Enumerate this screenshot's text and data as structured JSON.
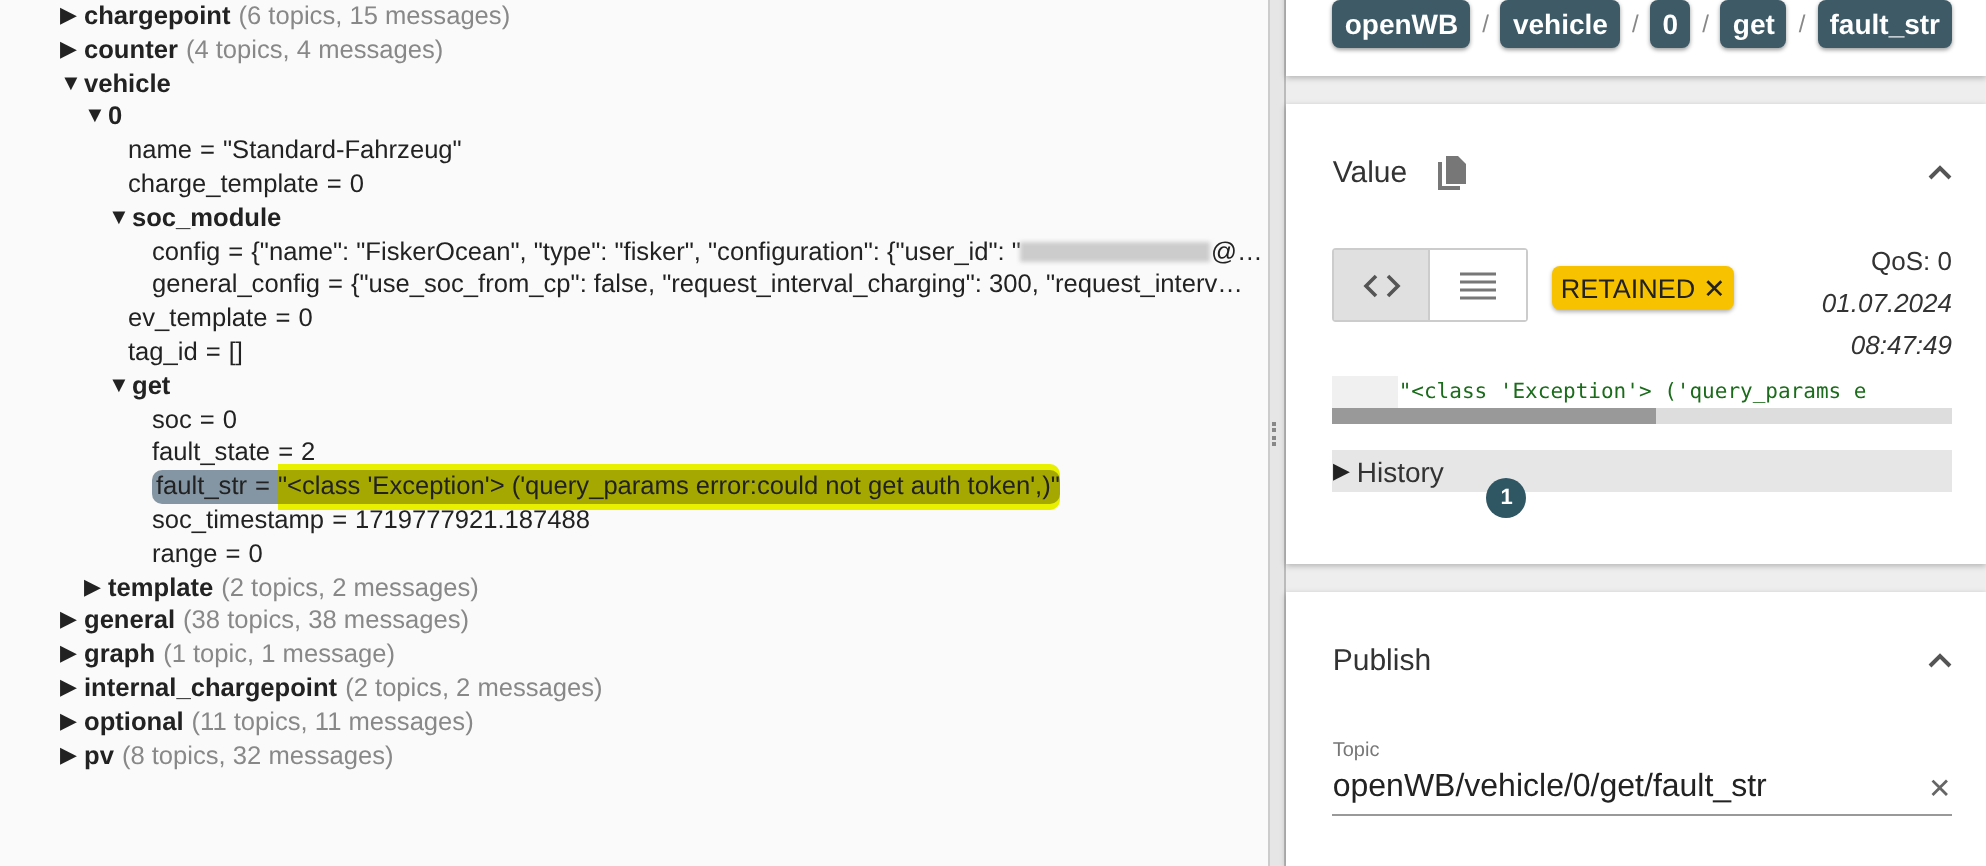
{
  "tree": [
    {
      "name": "chargepoint",
      "summary": "(6 topics, 15 messages)",
      "expanded": false,
      "selected": false
    },
    {
      "name": "counter",
      "summary": "(4 topics, 4 messages)",
      "expanded": false,
      "selected": false
    },
    {
      "name": "vehicle",
      "expanded": true,
      "selected": false,
      "children": [
        {
          "name": "0",
          "expanded": true,
          "selected": false,
          "children": [
            {
              "name": "name",
              "value": "\"Standard-Fahrzeug\"",
              "selected": false,
              "changed": false
            },
            {
              "name": "charge_template",
              "value": "0",
              "selected": false,
              "changed": false
            },
            {
              "name": "soc_module",
              "expanded": true,
              "selected": false,
              "children": [
                {
                  "name": "config",
                  "value": "{\"name\": \"FiskerOcean\", \"type\": \"fisker\", \"configuration\": {\"user_id\": \"",
                  "redacted": true,
                  "value_tail": "@…",
                  "selected": false,
                  "changed": false
                },
                {
                  "name": "general_config",
                  "value": "{\"use_soc_from_cp\": false, \"request_interval_charging\": 300, \"request_interv…",
                  "selected": false,
                  "changed": false
                }
              ]
            },
            {
              "name": "ev_template",
              "value": "0",
              "selected": false,
              "changed": false
            },
            {
              "name": "tag_id",
              "value": "[]",
              "selected": false,
              "changed": false
            },
            {
              "name": "get",
              "expanded": true,
              "selected": false,
              "children": [
                {
                  "name": "soc",
                  "value": "0",
                  "selected": false,
                  "changed": false
                },
                {
                  "name": "fault_state",
                  "value": "2",
                  "selected": false,
                  "changed": false
                },
                {
                  "name": "fault_str",
                  "value": "\"<class 'Exception'> ('query_params error:could not get auth token',)\"",
                  "selected": true,
                  "changed": true
                },
                {
                  "name": "soc_timestamp",
                  "value": "1719777921.187488",
                  "selected": false,
                  "changed": false
                },
                {
                  "name": "range",
                  "value": "0",
                  "selected": false,
                  "changed": false
                }
              ]
            }
          ]
        },
        {
          "name": "template",
          "summary": "(2 topics, 2 messages)",
          "expanded": false,
          "selected": false
        }
      ]
    },
    {
      "name": "general",
      "summary": "(38 topics, 38 messages)",
      "expanded": false,
      "selected": false
    },
    {
      "name": "graph",
      "summary": "(1 topic, 1 message)",
      "expanded": false,
      "selected": false
    },
    {
      "name": "internal_chargepoint",
      "summary": "(2 topics, 2 messages)",
      "expanded": false,
      "selected": false
    },
    {
      "name": "optional",
      "summary": "(11 topics, 11 messages)",
      "expanded": false,
      "selected": false
    },
    {
      "name": "pv",
      "summary": "(8 topics, 32 messages)",
      "expanded": false,
      "selected": false
    }
  ],
  "assign_sign": "=",
  "expand_glyph": "▼",
  "collapse_glyph": "▶",
  "breadcrumb": {
    "parts": [
      "openWB",
      "vehicle",
      "0",
      "get",
      "fault_str"
    ],
    "separator": "/"
  },
  "value_panel": {
    "title": "Value",
    "view_modes": [
      {
        "kind": "code",
        "selected": true
      },
      {
        "kind": "raw",
        "selected": false
      }
    ],
    "retained_label": "RETAINED",
    "retained_close": "✕",
    "qos": "QoS: 0",
    "date": "01.07.2024",
    "time": "08:47:49",
    "preview": "\"<class 'Exception'> ('query_params e",
    "history": {
      "label": "History",
      "glyph": "▶",
      "badge": "1"
    }
  },
  "publish_panel": {
    "title": "Publish",
    "topic": {
      "label": "Topic",
      "value": "openWB/vehicle/0/get/fault_str",
      "clear": "✕"
    }
  }
}
